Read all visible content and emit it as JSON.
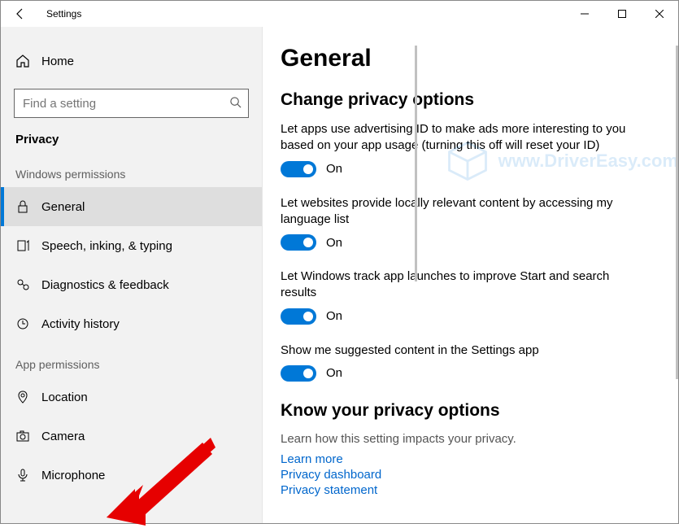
{
  "window": {
    "title": "Settings"
  },
  "sidebar": {
    "home": "Home",
    "search_placeholder": "Find a setting",
    "category": "Privacy",
    "section_win": "Windows permissions",
    "section_app": "App permissions",
    "win_items": [
      {
        "label": "General"
      },
      {
        "label": "Speech, inking, & typing"
      },
      {
        "label": "Diagnostics & feedback"
      },
      {
        "label": "Activity history"
      }
    ],
    "app_items": [
      {
        "label": "Location"
      },
      {
        "label": "Camera"
      },
      {
        "label": "Microphone"
      }
    ]
  },
  "main": {
    "heading": "General",
    "sub1": "Change privacy options",
    "settings": [
      {
        "desc": "Let apps use advertising ID to make ads more interesting to you based on your app usage (turning this off will reset your ID)",
        "state_label": "On"
      },
      {
        "desc": "Let websites provide locally relevant content by accessing my language list",
        "state_label": "On"
      },
      {
        "desc": "Let Windows track app launches to improve Start and search results",
        "state_label": "On"
      },
      {
        "desc": "Show me suggested content in the Settings app",
        "state_label": "On"
      }
    ],
    "sub2": "Know your privacy options",
    "know_desc": "Learn how this setting impacts your privacy.",
    "links": [
      "Learn more",
      "Privacy dashboard",
      "Privacy statement"
    ]
  },
  "watermark_text": "www.DriverEasy.com"
}
